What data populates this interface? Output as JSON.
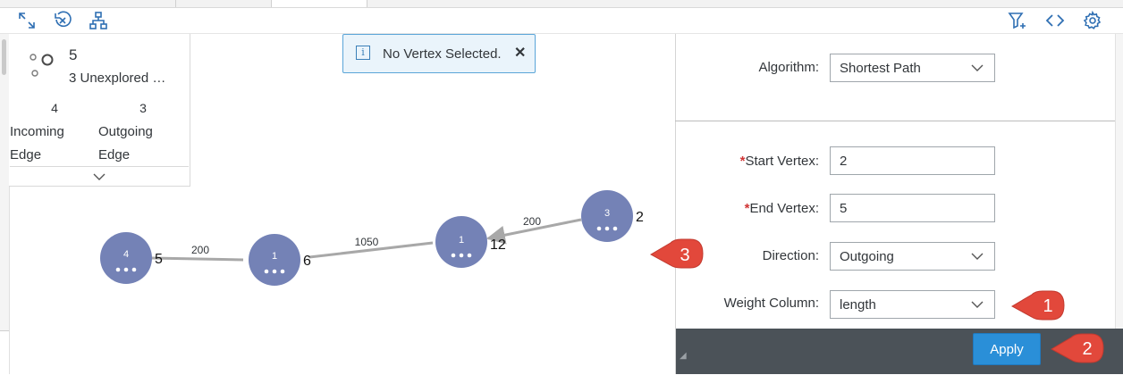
{
  "toolbar": {
    "left_icons": [
      "fullscreen-icon",
      "clear-icon",
      "hierarchy-icon"
    ],
    "right_icons": [
      "filter-add-icon",
      "code-icon",
      "settings-icon"
    ]
  },
  "summary": {
    "vertex_count": "5",
    "unexplored": "3 Unexplored …",
    "incoming_count": "4",
    "incoming_label": "Incoming",
    "incoming_sub": "Edge",
    "outgoing_count": "3",
    "outgoing_label": "Outgoing",
    "outgoing_sub": "Edge"
  },
  "toast": {
    "message": "No Vertex Selected.",
    "close": "✕",
    "info": "i"
  },
  "graph": {
    "vertices": [
      {
        "badge": "4",
        "label": "5"
      },
      {
        "badge": "1",
        "label": "6"
      },
      {
        "badge": "1",
        "label": "12"
      },
      {
        "badge": "3",
        "label": "2"
      }
    ],
    "edges": [
      {
        "weight": "200"
      },
      {
        "weight": "1050"
      },
      {
        "weight": "200"
      }
    ],
    "vertex_color": "#7482b6",
    "edge_color": "#a8a8a8"
  },
  "form": {
    "algorithm_label": "Algorithm:",
    "algorithm_value": "Shortest Path",
    "start_label": "Start Vertex:",
    "start_value": "2",
    "end_label": "End Vertex:",
    "end_value": "5",
    "direction_label": "Direction:",
    "direction_value": "Outgoing",
    "weight_label": "Weight Column:",
    "weight_value": "length",
    "required_mark": "*",
    "apply_label": "Apply"
  },
  "callouts": [
    "1",
    "2",
    "3"
  ],
  "colors": {
    "accent": "#2a8fd8",
    "callout": "#e2483b",
    "footer": "#4b5258",
    "required": "#d03535"
  }
}
